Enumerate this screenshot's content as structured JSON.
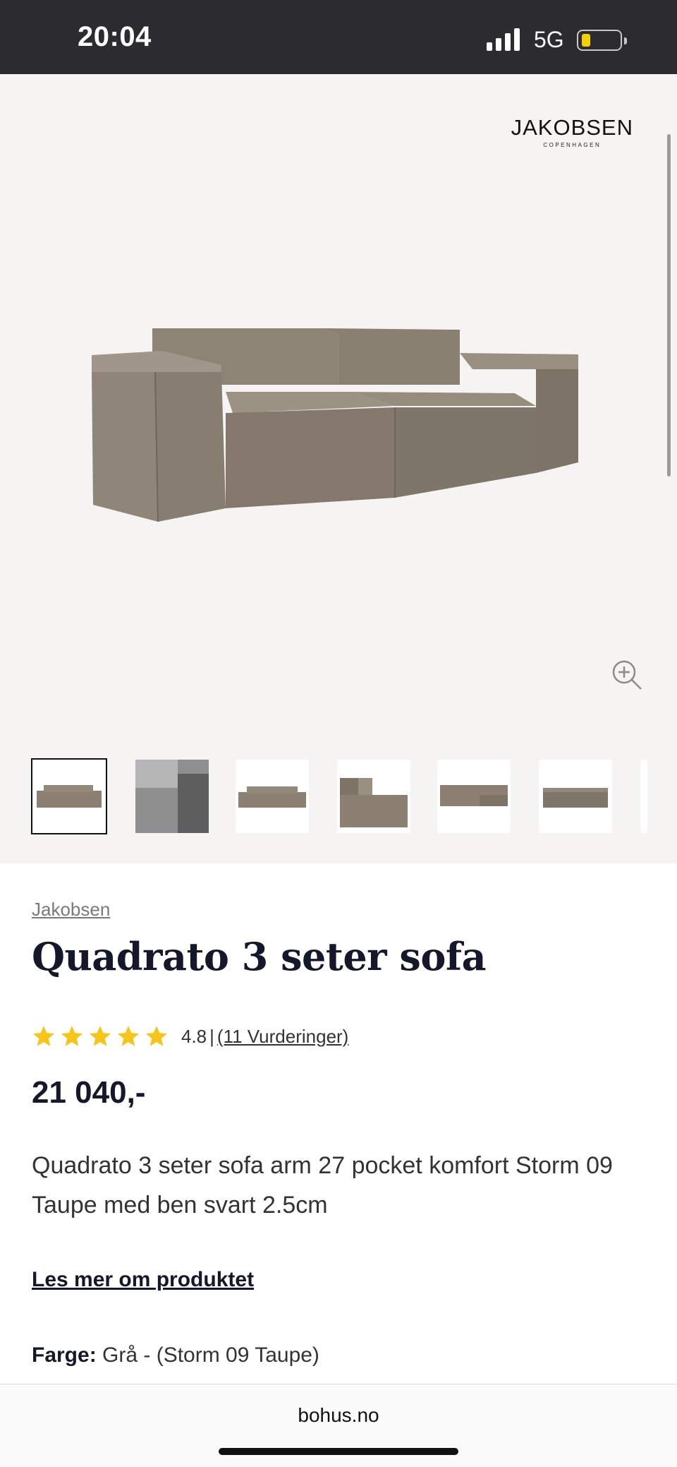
{
  "status_bar": {
    "time": "20:04",
    "network": "5G"
  },
  "gallery": {
    "brand_logo": {
      "word": "JAKOBSEN",
      "sub": "COPENHAGEN"
    },
    "thumbnail_count": 7
  },
  "product": {
    "brand": "Jakobsen",
    "title": "Quadrato 3 seter sofa",
    "rating": {
      "score": "4.8",
      "separator": "|",
      "reviews": "(11 Vurderinger)",
      "stars": 5
    },
    "price": "21 040,-",
    "description": "Quadrato 3 seter sofa arm 27 pocket komfort Storm 09 Taupe med ben svart 2.5cm",
    "read_more": "Les mer om produktet",
    "color_label": "Farge:",
    "color_value": "Grå - (Storm 09 Taupe)"
  },
  "browser": {
    "url": "bohus.no"
  },
  "colors": {
    "star": "#f5c518",
    "title": "#14182a",
    "sofa": "#8b8072",
    "status_bar": "#2b2b30",
    "battery": "#f5d000"
  }
}
